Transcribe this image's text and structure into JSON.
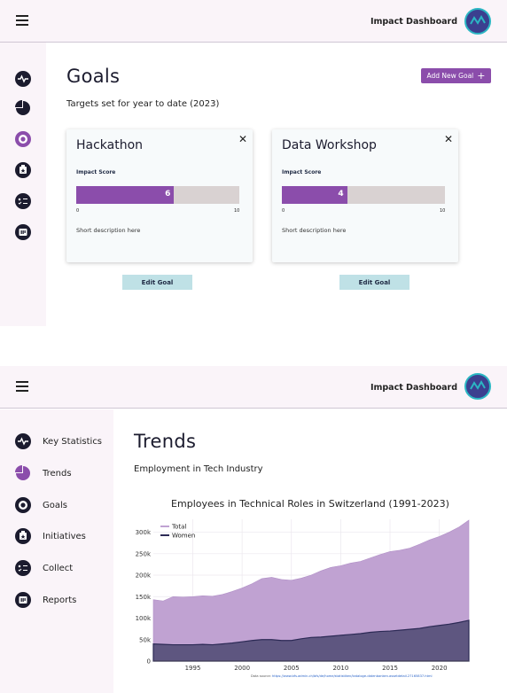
{
  "app": {
    "name": "Impact Dashboard"
  },
  "goals_view": {
    "title": "Goals",
    "subtitle": "Targets set for year to date (2023)",
    "add_button_label": "Add New Goal",
    "cards": [
      {
        "title": "Hackathon",
        "impact_label": "Impact Score",
        "score": 6,
        "score_text": "6",
        "min": "0",
        "max": "10",
        "description": "Short description here",
        "edit_label": "Edit Goal"
      },
      {
        "title": "Data Workshop",
        "impact_label": "Impact Score",
        "score": 4,
        "score_text": "4",
        "min": "0",
        "max": "10",
        "description": "Short description here",
        "edit_label": "Edit Goal"
      }
    ]
  },
  "trends_view": {
    "title": "Trends",
    "subtitle": "Employment in Tech Industry",
    "nav": [
      {
        "label": "Key Statistics",
        "icon": "pulse-icon"
      },
      {
        "label": "Trends",
        "icon": "pie-chart-icon"
      },
      {
        "label": "Goals",
        "icon": "target-icon"
      },
      {
        "label": "Initiatives",
        "icon": "initiatives-icon"
      },
      {
        "label": "Collect",
        "icon": "checklist-icon"
      },
      {
        "label": "Reports",
        "icon": "reports-icon"
      }
    ],
    "source_prefix": "Data source: ",
    "source_link": "https://www.bfs.admin.ch/bfs/de/home/statistiken/kataloge-datenbanken.assetdetail.27165837.html"
  },
  "colors": {
    "accent": "#8b4dab",
    "total_area": "#c0a2d2",
    "women_area": "#5e5680",
    "edit_button": "#bfe1e6"
  },
  "chart_data": {
    "type": "area",
    "title": "Employees in Technical Roles in Switzerland (1991-2023)",
    "x": [
      1991,
      1992,
      1993,
      1994,
      1995,
      1996,
      1997,
      1998,
      1999,
      2000,
      2001,
      2002,
      2003,
      2004,
      2005,
      2006,
      2007,
      2008,
      2009,
      2010,
      2011,
      2012,
      2013,
      2014,
      2015,
      2016,
      2017,
      2018,
      2019,
      2020,
      2021,
      2022,
      2023
    ],
    "series": [
      {
        "name": "Total",
        "values": [
          143000,
          140000,
          150000,
          149000,
          150000,
          152000,
          151000,
          155000,
          162000,
          170000,
          180000,
          192000,
          195000,
          190000,
          188000,
          193000,
          200000,
          210000,
          218000,
          222000,
          228000,
          232000,
          240000,
          248000,
          255000,
          258000,
          263000,
          272000,
          282000,
          290000,
          300000,
          312000,
          328000
        ]
      },
      {
        "name": "Women",
        "values": [
          40000,
          39000,
          38000,
          38000,
          38000,
          39000,
          38000,
          40000,
          42000,
          45000,
          48000,
          50000,
          50000,
          48000,
          48000,
          52000,
          55000,
          56000,
          58000,
          60000,
          62000,
          64000,
          67000,
          69000,
          70000,
          72000,
          74000,
          76000,
          80000,
          83000,
          86000,
          90000,
          95000
        ]
      }
    ],
    "x_ticks": [
      1995,
      2000,
      2005,
      2010,
      2015,
      2020
    ],
    "y_ticks": [
      0,
      50000,
      100000,
      150000,
      200000,
      250000,
      300000
    ],
    "y_tick_labels": [
      "0",
      "50k",
      "100k",
      "150k",
      "200k",
      "250k",
      "300k"
    ],
    "ylim": [
      0,
      330000
    ],
    "legend_position": "top-left",
    "grid": true
  }
}
